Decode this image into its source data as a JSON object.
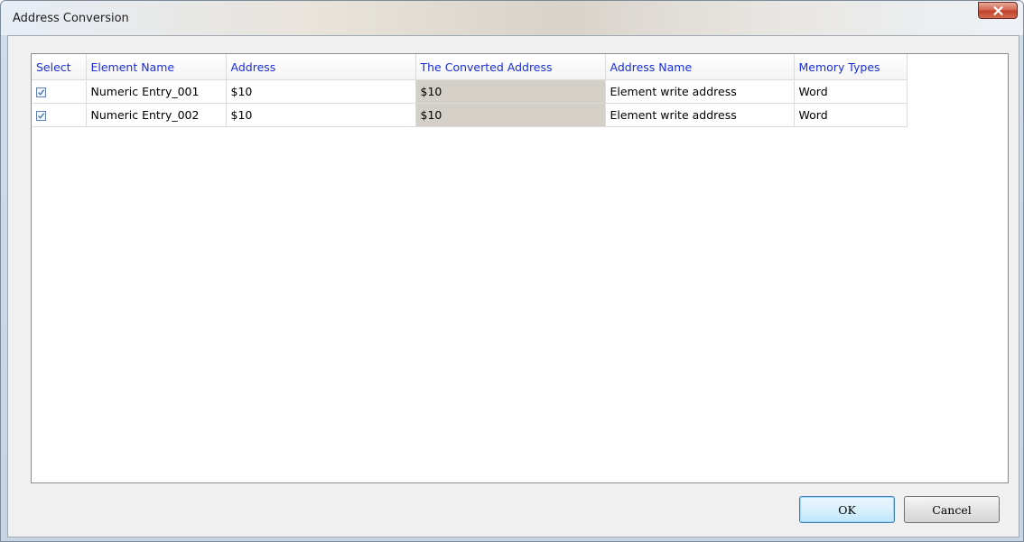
{
  "window": {
    "title": "Address Conversion"
  },
  "grid": {
    "columns": [
      {
        "label": "Select"
      },
      {
        "label": "Element Name"
      },
      {
        "label": "Address"
      },
      {
        "label": "The Converted Address"
      },
      {
        "label": "Address Name"
      },
      {
        "label": "Memory Types"
      }
    ],
    "rows": [
      {
        "selected": true,
        "element_name": "Numeric Entry_001",
        "address": "$10",
        "converted_address": "$10",
        "address_name": "Element write address",
        "memory_type": "Word"
      },
      {
        "selected": true,
        "element_name": "Numeric Entry_002",
        "address": "$10",
        "converted_address": "$10",
        "address_name": "Element write address",
        "memory_type": "Word"
      }
    ]
  },
  "buttons": {
    "ok_label": "OK",
    "cancel_label": "Cancel"
  },
  "colors": {
    "header_text": "#1a2ee0",
    "converted_cell_bg": "#d4d0c8",
    "close_button": "#c2422b"
  },
  "icons": {
    "close": "close-icon",
    "checkbox": "checkbox-checked-icon"
  }
}
